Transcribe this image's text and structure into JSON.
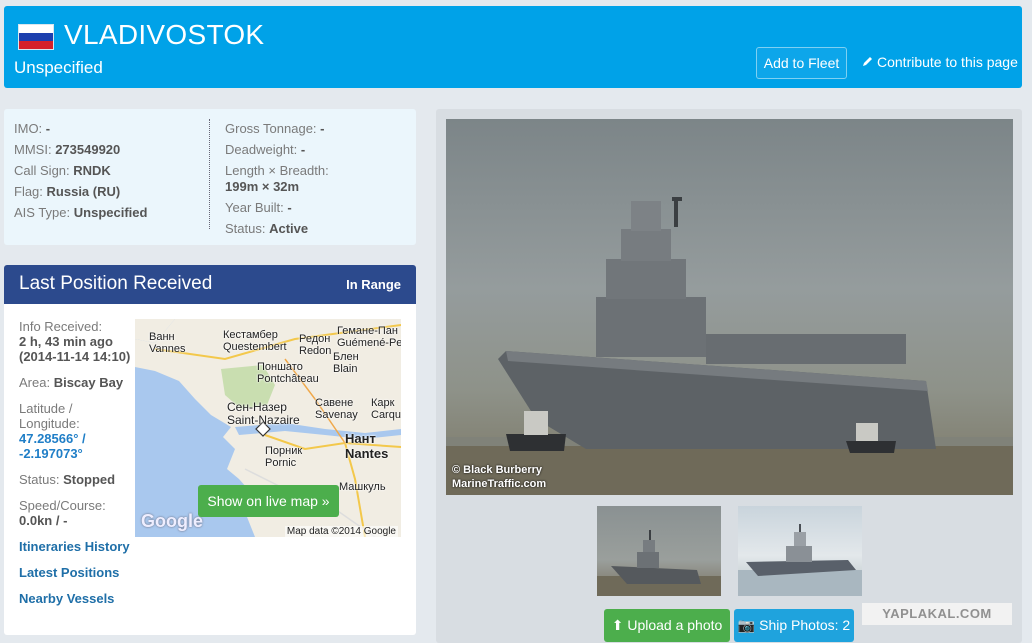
{
  "header": {
    "ship_name": "VLADIVOSTOK",
    "ship_type": "Unspecified",
    "flag_icon": "russia-flag-icon",
    "add_to_fleet": "Add to Fleet",
    "contribute": "Contribute to this page"
  },
  "info": {
    "imo_label": "IMO:",
    "imo": "-",
    "mmsi_label": "MMSI:",
    "mmsi": "273549920",
    "callsign_label": "Call Sign:",
    "callsign": "RNDK",
    "flag_label": "Flag:",
    "flag": "Russia (RU)",
    "ais_label": "AIS Type:",
    "ais": "Unspecified",
    "gross_label": "Gross Tonnage:",
    "gross": "-",
    "deadweight_label": "Deadweight:",
    "deadweight": "-",
    "size_label": "Length × Breadth:",
    "size": "199m × 32m",
    "year_label": "Year Built:",
    "year": "-",
    "status_label": "Status:",
    "status": "Active"
  },
  "position": {
    "title": "Last Position Received",
    "badge": "In Range",
    "received_label": "Info Received:",
    "received_ago": "2 h, 43 min ago",
    "received_time": "(2014-11-14 14:10)",
    "area_label": "Area:",
    "area": "Biscay Bay",
    "latlon_label_1": "Latitude /",
    "latlon_label_2": "Longitude:",
    "lat": "47.28566° /",
    "lon": "-2.197073°",
    "status_label": "Status:",
    "status": "Stopped",
    "speed_label": "Speed/Course:",
    "speed": "0.0kn / -",
    "link_itineraries": "Itineraries History",
    "link_positions": "Latest Positions",
    "link_nearby": "Nearby Vessels",
    "map": {
      "show_live": "Show on live map",
      "credit": "Map data ©2014 Google",
      "google": "Google",
      "labels": {
        "vannes": "Ванн\nVannes",
        "questembert": "Кестамбер\nQuestembert",
        "redon": "Редон\nRedon",
        "guemene": "Гемане-Пан\nGuémené-Pe",
        "pontchateau": "Поншато\nPontchâteau",
        "blain": "Блен\nBlain",
        "savenay": "Савене\nSavenay",
        "stnazaire": "Сен-Назер\nSaint-Nazaire",
        "carquefou": "Карк\nCarqu",
        "nantes": "Нант\nNantes",
        "pornic": "Порник\nPornic",
        "machecoul": "Машкуль"
      }
    }
  },
  "photos": {
    "credit_line1": "© Black Burberry",
    "credit_line2": "MarineTraffic.com",
    "upload": "Upload a photo",
    "ship_photos": "Ship Photos: 2"
  },
  "watermark": "YAPLAKAL.COM"
}
